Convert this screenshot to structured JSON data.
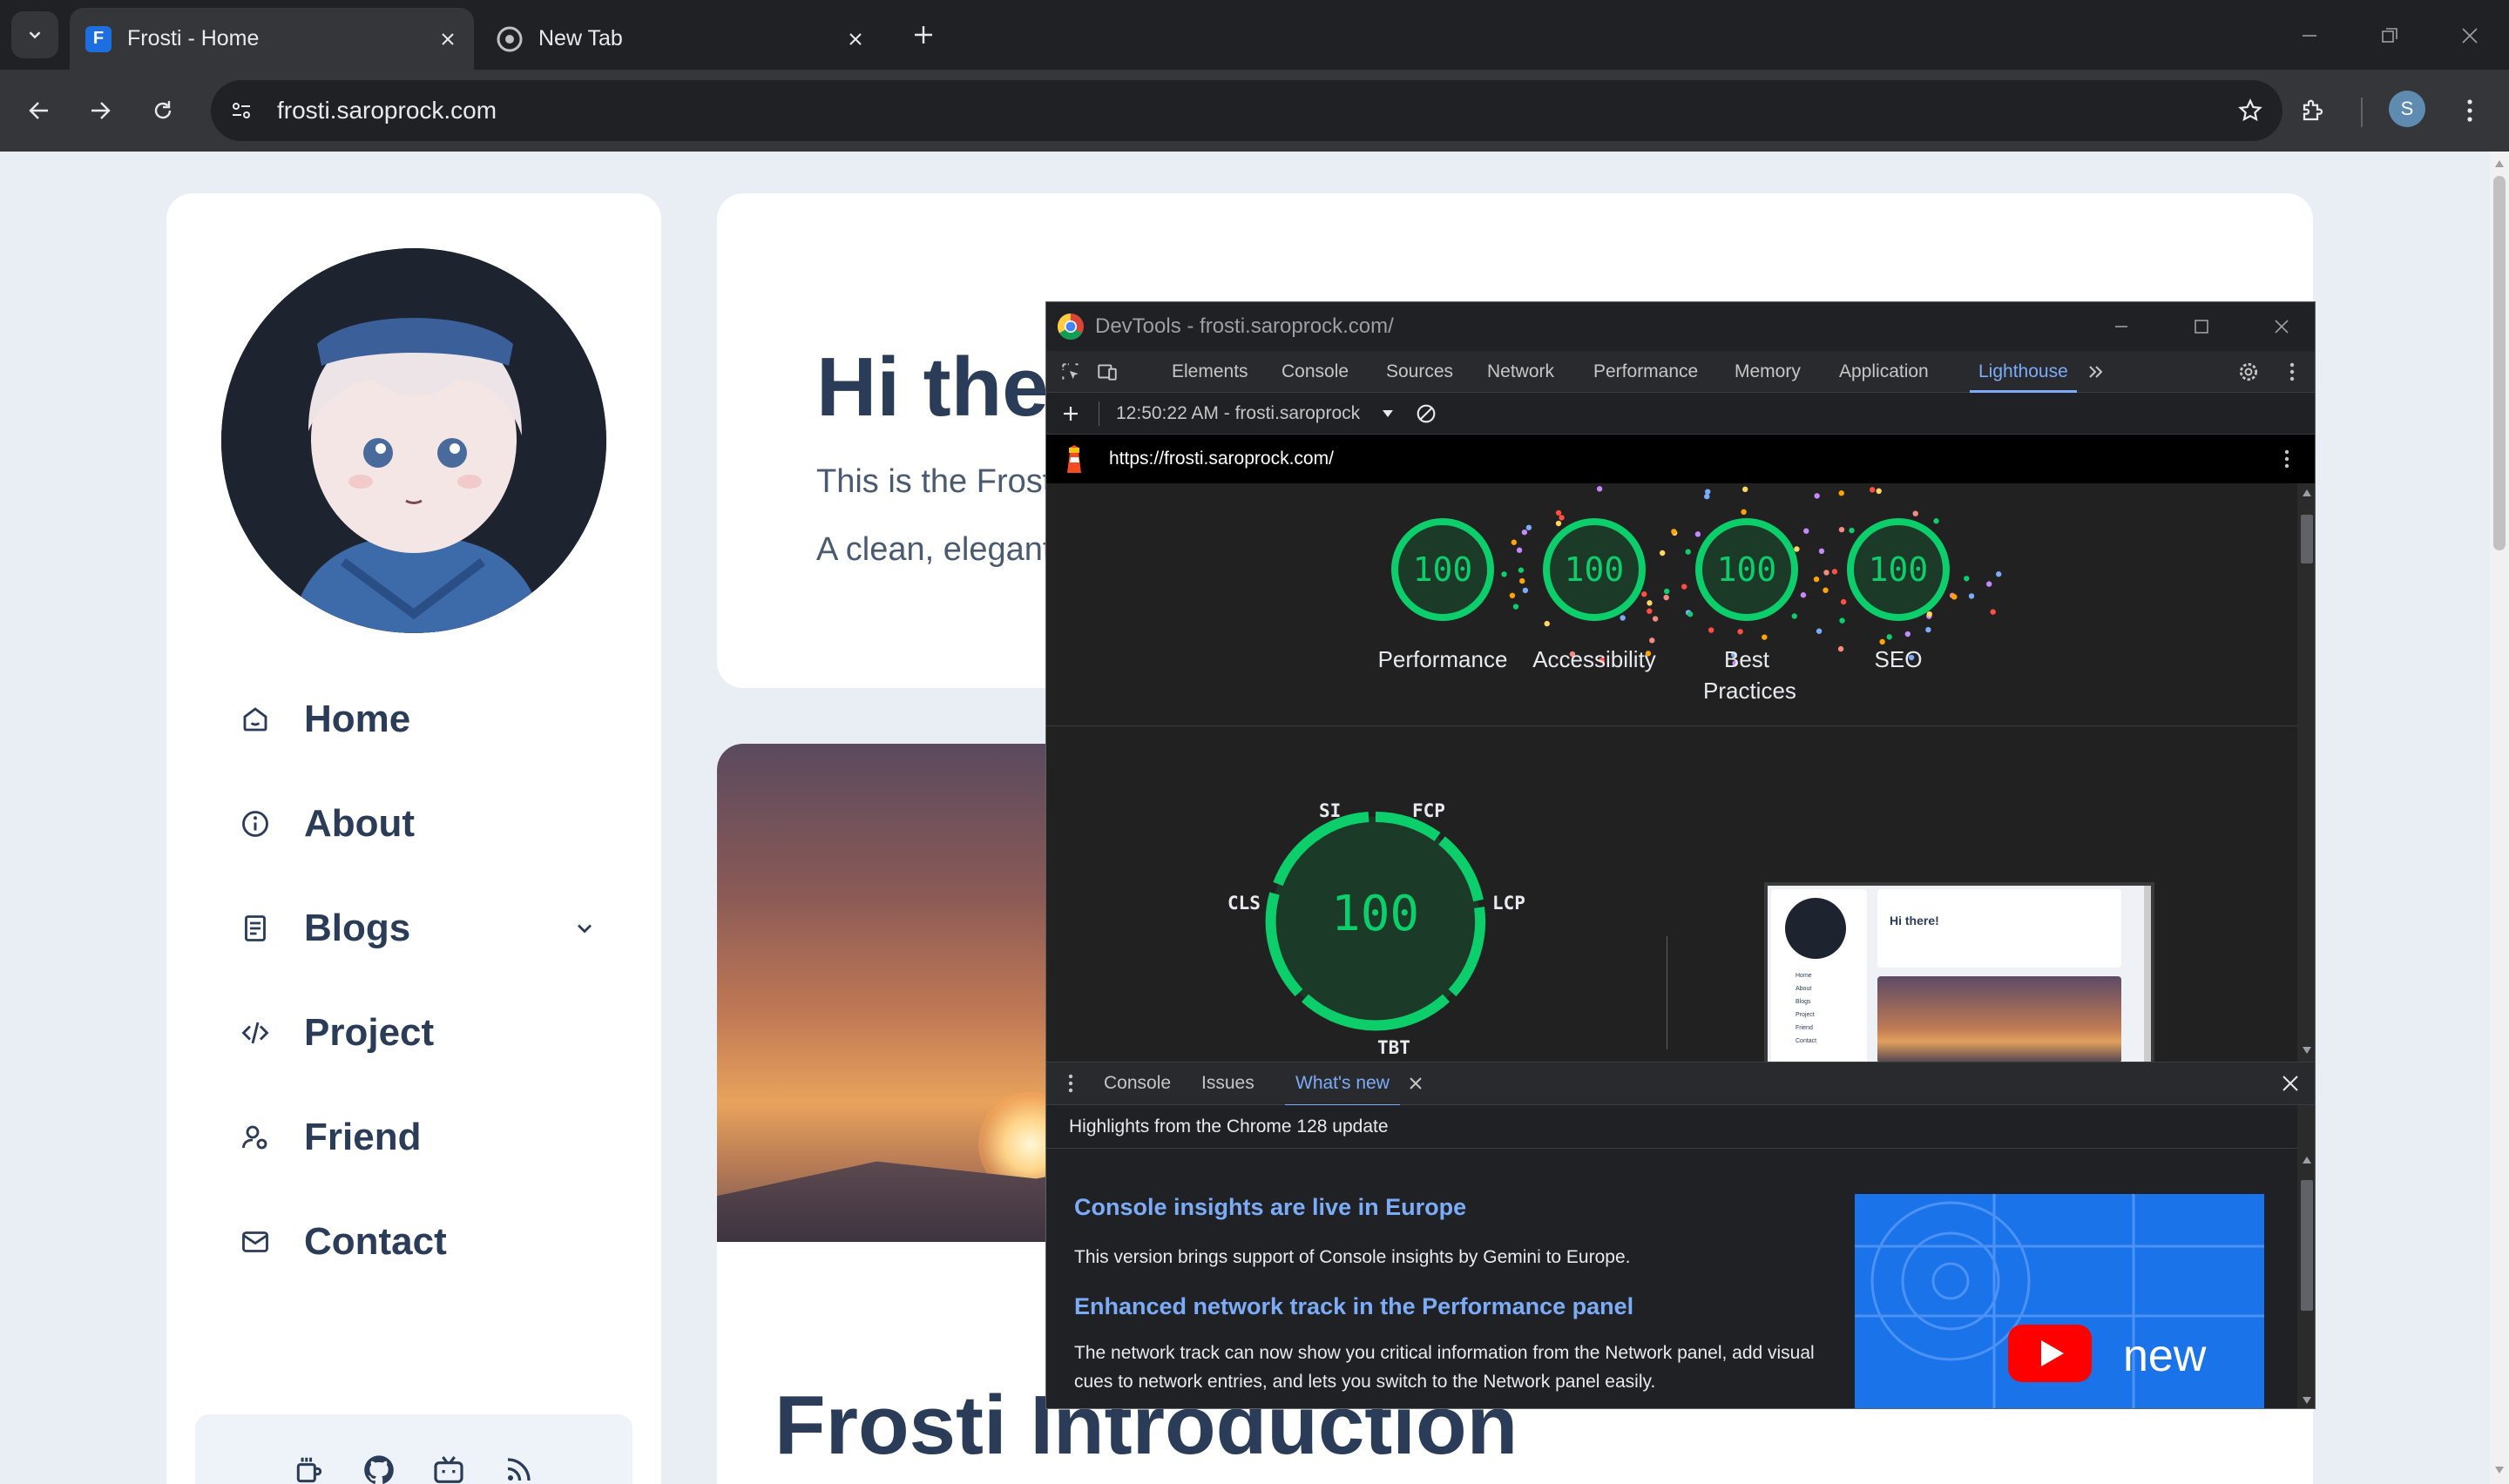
{
  "browser": {
    "tabs": [
      {
        "title": "Frosti - Home",
        "favicon": "frosti-favicon"
      },
      {
        "title": "New Tab",
        "favicon": "chrome-favicon"
      }
    ],
    "url": "frosti.saroprock.com",
    "profile_initial": "S"
  },
  "sidebar": {
    "nav": [
      {
        "label": "Home",
        "icon": "home-icon"
      },
      {
        "label": "About",
        "icon": "info-icon"
      },
      {
        "label": "Blogs",
        "icon": "book-icon"
      },
      {
        "label": "Project",
        "icon": "code-icon"
      },
      {
        "label": "Friend",
        "icon": "friend-icon"
      },
      {
        "label": "Contact",
        "icon": "mail-icon"
      }
    ],
    "social": [
      "coffee-icon",
      "github-icon",
      "bilibili-icon",
      "rss-icon"
    ]
  },
  "hero": {
    "title": "Hi there!",
    "line1": "This is the Frosti theme.",
    "line2": "A clean, elegant and fast static blog template."
  },
  "intro": {
    "title": "Frosti Introduction"
  },
  "devtools": {
    "window_title": "DevTools - frosti.saroprock.com/",
    "tabs": [
      "Elements",
      "Console",
      "Sources",
      "Network",
      "Performance",
      "Memory",
      "Application",
      "Lighthouse"
    ],
    "active_tab": "Lighthouse",
    "report_selector": "12:50:22 AM - frosti.saroprock",
    "report_url": "https://frosti.saroprock.com/",
    "scores": [
      {
        "label": "Performance",
        "score": "100"
      },
      {
        "label": "Accessibility",
        "score": "100"
      },
      {
        "label": "Best Practices",
        "score": "100"
      },
      {
        "label": "SEO",
        "score": "100"
      }
    ],
    "perf_gauge": {
      "score": "100",
      "metrics": [
        "SI",
        "FCP",
        "LCP",
        "TBT",
        "CLS"
      ]
    },
    "screenshot": {
      "title": "Hi there!",
      "nav": [
        "Home",
        "About",
        "Blogs",
        "Project",
        "Friend",
        "Contact"
      ]
    },
    "drawer_tabs": [
      "Console",
      "Issues",
      "What's new"
    ],
    "whats_new": {
      "header": "Highlights from the Chrome 128 update",
      "items": [
        {
          "title": "Console insights are live in Europe",
          "text": "This version brings support of Console insights by Gemini to Europe."
        },
        {
          "title": "Enhanced network track in the Performance panel",
          "text": "The network track can now show you critical information from the Network panel, add visual cues to network entries, and lets you switch to the Network panel easily."
        }
      ],
      "banner_text": "new"
    }
  },
  "colors": {
    "accent": "#7cacf8",
    "score_good": "#0cce6b",
    "heading": "#2a3c57"
  }
}
